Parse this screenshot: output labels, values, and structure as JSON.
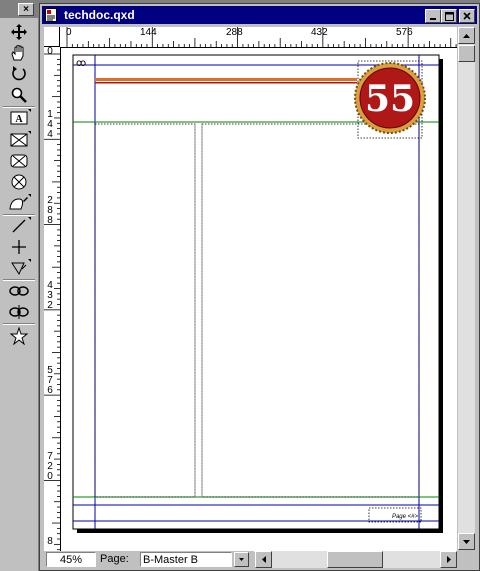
{
  "window": {
    "title": "techdoc.qxd"
  },
  "palette": {
    "close_label": "×"
  },
  "tools": [
    "item-tool",
    "content-tool",
    "rotation-tool",
    "zoom-tool",
    "text-box-tool",
    "rectangle-picture-box-tool",
    "rounded-rectangle-picture-box-tool",
    "oval-picture-box-tool",
    "bezier-picture-box-tool",
    "line-tool",
    "orthogonal-line-tool",
    "bezier-line-tool",
    "linking-tool",
    "unlinking-tool",
    "star-tool"
  ],
  "hruler": {
    "labels": [
      "0",
      "144",
      "288",
      "432",
      "576"
    ]
  },
  "vruler": {
    "labels": [
      "0",
      "1\n4\n4",
      "2\n8\n8",
      "4\n3\n2",
      "5\n7\n6",
      "7\n2\n0",
      "8"
    ]
  },
  "canvas": {
    "badge_number": "55",
    "master_marker": "ꝏ",
    "footer_text": "Page <#>"
  },
  "status": {
    "zoom": "45%",
    "page_label": "Page:",
    "page_value": "B-Master B"
  },
  "colors": {
    "titlebar": "#000080",
    "margin_guide": "#0000a0",
    "ruler_guide": "#008000",
    "badge_red": "#b01818",
    "rule_orange": "#e07020",
    "rule_red": "#c01010"
  }
}
